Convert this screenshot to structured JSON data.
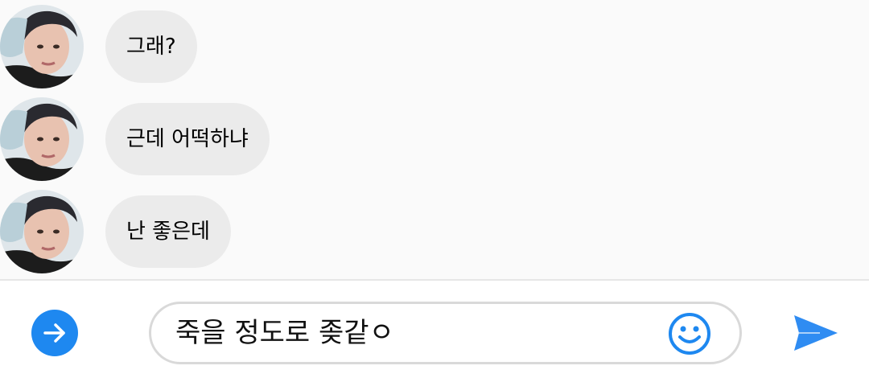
{
  "messages": [
    {
      "text": "그래?"
    },
    {
      "text": "근데 어떡하냐"
    },
    {
      "text": "난 좋은데"
    }
  ],
  "composer": {
    "input_value": "죽을 정도로 좆같ㅇ",
    "accent_color": "#1e88f0",
    "left_icon": "arrow-right-icon",
    "emoji_icon": "smiley-icon",
    "send_icon": "send-icon"
  }
}
